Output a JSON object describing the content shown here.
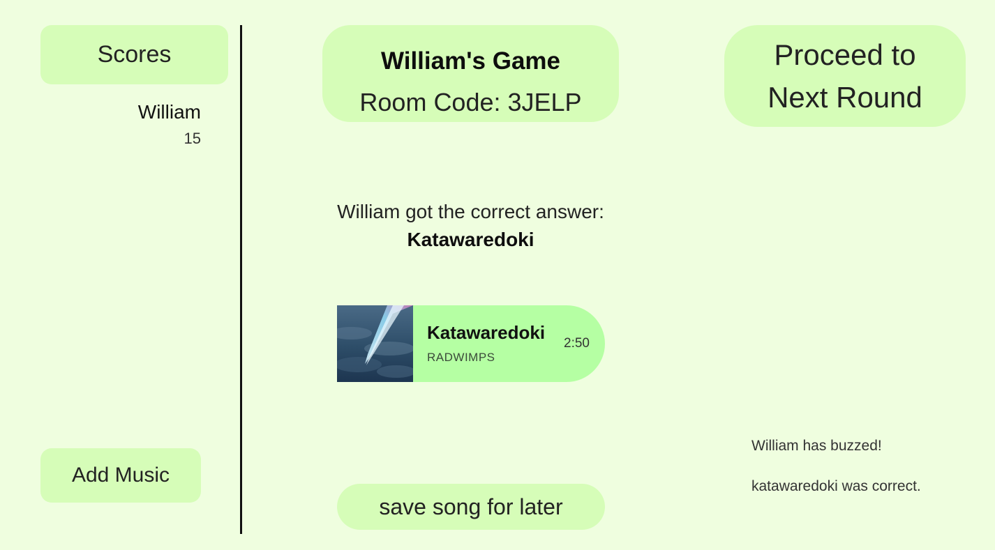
{
  "sidebar": {
    "scores_label": "Scores",
    "players": [
      {
        "name": "William",
        "score": "15"
      }
    ],
    "add_music_label": "Add Music"
  },
  "main": {
    "game_title": "William's Game",
    "room_code": "Room Code: 3JELP",
    "result_prefix": "William got the correct answer: ",
    "result_song": "Katawaredoki",
    "song_card": {
      "title": "Katawaredoki",
      "artist": "RADWIMPS",
      "duration": "2:50"
    },
    "save_song_label": "save song for later"
  },
  "right": {
    "proceed_label": "Proceed to Next Round",
    "log": [
      "William has buzzed!",
      "katawaredoki was correct."
    ]
  },
  "colors": {
    "background": "#effedf",
    "button": "#d6fdb8",
    "song_card": "#b5ffa3"
  }
}
